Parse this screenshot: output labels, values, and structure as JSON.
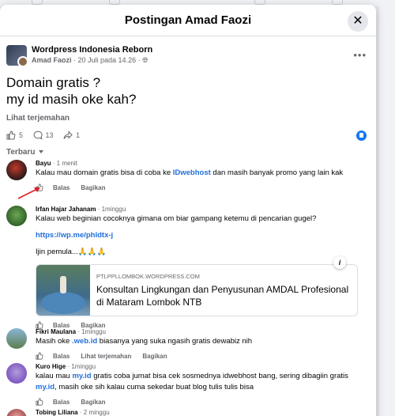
{
  "modal": {
    "title": "Postingan Amad Faozi"
  },
  "post": {
    "group_name": "Wordpress Indonesia Reborn",
    "author": "Amad Faozi",
    "date": "20 Juli pada 14.26",
    "body_line1": "Domain gratis ?",
    "body_line2": "my id masih oke kah?",
    "translate_label": "Lihat terjemahan",
    "reactions": "5",
    "comments_count": "13",
    "shares": "1"
  },
  "sort_label": "Terbaru",
  "comments": [
    {
      "name": "Bayu",
      "time": "1 menit",
      "text_pre": "Kalau mau domain gratis bisa di coba ke ",
      "link": "IDwebhost",
      "text_post": " dan masih banyak promo yang lain kak",
      "actions": [
        "Balas",
        "Bagikan"
      ]
    },
    {
      "name": "Irfan Hajar Jahanam",
      "time": "1minggu",
      "text": "Kalau web beginian cocoknya gimana om biar gampang ketemu di pencarian gugel?",
      "url": "https://wp.me/phldtx-j",
      "line3": "Ijin pemula...",
      "preview_domain": "PTLPPLLOMBOK.WORDPRESS.COM",
      "preview_title": "Konsultan Lingkungan dan Penyusunan AMDAL Profesional di Mataram Lombok NTB",
      "actions": [
        "Balas",
        "Bagikan"
      ]
    },
    {
      "name": "Fikri Maulana",
      "time": "1minggu",
      "text_pre": "Masih oke ",
      "link": ".web.id",
      "text_post": " biasanya yang suka ngasih gratis dewabiz nih",
      "actions": [
        "Balas",
        "Lihat terjemahan",
        "Bagikan"
      ]
    },
    {
      "name": "Kuro Hige",
      "time": "1minggu",
      "text_a": "kalau mau ",
      "link1": "my.id",
      "text_b": " gratis coba jumat bisa cek sosmednya idwebhost bang, sering dibagiin gratis ",
      "link2": "my.id",
      "text_c": ", masih oke sih kalau cuma sekedar buat blog tulis tulis bisa",
      "actions": [
        "Balas",
        "Bagikan"
      ]
    },
    {
      "name": "Tobing Liliana",
      "time": "2 minggu"
    }
  ],
  "colors": {
    "accent": "#216fdb",
    "like": "#1877f2",
    "arrow": "#e41e26"
  }
}
